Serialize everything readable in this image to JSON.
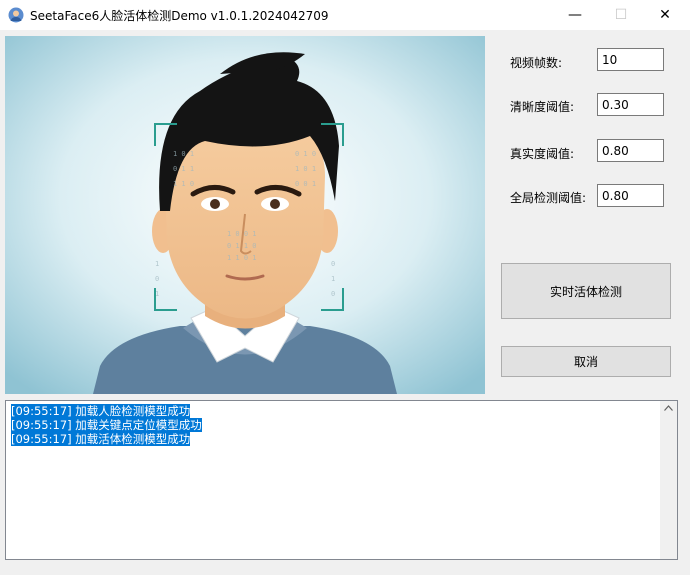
{
  "window": {
    "title": "SeetaFace6人脸活体检测Demo v1.0.1.2024042709",
    "minimize_glyph": "—",
    "maximize_glyph": "☐",
    "close_glyph": "✕"
  },
  "settings": {
    "frames_label": "视频帧数:",
    "frames_value": "10",
    "clarity_label": "清晰度阈值:",
    "clarity_value": "0.30",
    "reality_label": "真实度阈值:",
    "reality_value": "0.80",
    "global_label": "全局检测阈值:",
    "global_value": "0.80"
  },
  "buttons": {
    "detect_label": "实时活体检测",
    "cancel_label": "取消"
  },
  "log": {
    "lines": [
      "[09:55:17] 加载人脸检测模型成功",
      "[09:55:17] 加载关键点定位模型成功",
      "[09:55:17] 加载活体检测模型成功"
    ]
  },
  "colors": {
    "selection": "#0078d7",
    "accent_scan": "#2a9d8f"
  }
}
